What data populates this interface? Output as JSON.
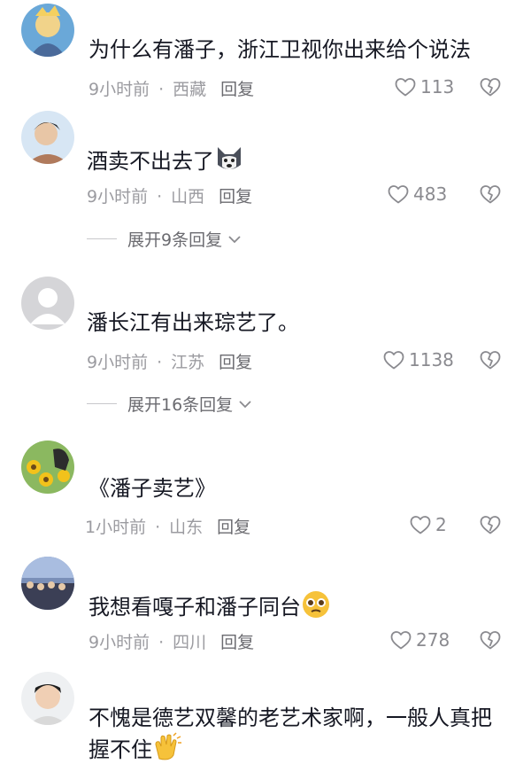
{
  "comments": [
    {
      "text": "为什么有潘子，浙江卫视你出来给个说法",
      "time": "9小时前",
      "location": "西藏",
      "reply": "回复",
      "likes": "113"
    },
    {
      "text": "酒卖不出去了",
      "emoji": "husky-emoji",
      "time": "9小时前",
      "location": "山西",
      "reply": "回复",
      "likes": "483",
      "expand": "展开9条回复"
    },
    {
      "text": "潘长江有出来琮艺了。",
      "time": "9小时前",
      "location": "江苏",
      "reply": "回复",
      "likes": "1138",
      "expand": "展开16条回复"
    },
    {
      "text": "《潘子卖艺》",
      "time": "1小时前",
      "location": "山东",
      "reply": "回复",
      "likes": "2"
    },
    {
      "text": "我想看嘎子和潘子同台",
      "emoji": "pleading-face-emoji",
      "time": "9小时前",
      "location": "四川",
      "reply": "回复",
      "likes": "278"
    },
    {
      "text": "不愧是德艺双馨的老艺术家啊，一般人真把握不住",
      "emoji": "clapping-hands-emoji"
    }
  ],
  "separator": "·",
  "colors": {
    "text": "#161823",
    "meta": "#9b9ba0",
    "reply": "#6b6b70"
  }
}
